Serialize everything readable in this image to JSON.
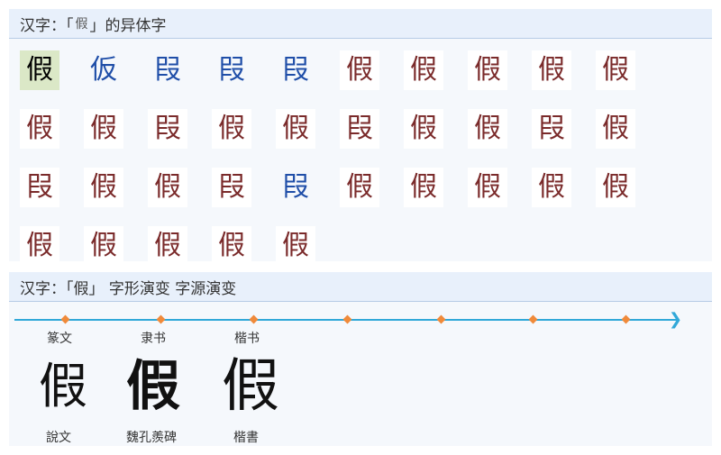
{
  "variants_section": {
    "title_prefix": "汉字：「",
    "title_char": "假",
    "title_suffix": "」的异体字",
    "glyphs": [
      {
        "char": "假",
        "style": "selected"
      },
      {
        "char": "仮",
        "style": "blue"
      },
      {
        "char": "叚",
        "style": "blue"
      },
      {
        "char": "叚",
        "style": "blue"
      },
      {
        "char": "叚",
        "style": "blue"
      },
      {
        "char": "假",
        "style": "red"
      },
      {
        "char": "假",
        "style": "red"
      },
      {
        "char": "假",
        "style": "red"
      },
      {
        "char": "假",
        "style": "red"
      },
      {
        "char": "假",
        "style": "red"
      },
      {
        "char": "假",
        "style": "red"
      },
      {
        "char": "假",
        "style": "red"
      },
      {
        "char": "叚",
        "style": "red"
      },
      {
        "char": "假",
        "style": "red"
      },
      {
        "char": "假",
        "style": "red"
      },
      {
        "char": "叚",
        "style": "red"
      },
      {
        "char": "假",
        "style": "red"
      },
      {
        "char": "假",
        "style": "red"
      },
      {
        "char": "叚",
        "style": "red"
      },
      {
        "char": "假",
        "style": "red"
      },
      {
        "char": "叚",
        "style": "red"
      },
      {
        "char": "假",
        "style": "red"
      },
      {
        "char": "假",
        "style": "red"
      },
      {
        "char": "叚",
        "style": "red"
      },
      {
        "char": "叚",
        "style": "blue"
      },
      {
        "char": "假",
        "style": "red"
      },
      {
        "char": "假",
        "style": "red"
      },
      {
        "char": "假",
        "style": "red"
      },
      {
        "char": "假",
        "style": "red"
      },
      {
        "char": "假",
        "style": "red"
      },
      {
        "char": "假",
        "style": "red"
      },
      {
        "char": "假",
        "style": "red"
      },
      {
        "char": "假",
        "style": "red"
      },
      {
        "char": "假",
        "style": "red"
      },
      {
        "char": "假",
        "style": "red"
      }
    ]
  },
  "evolution_section": {
    "title": "汉字：「假」 字形演变 字源演变",
    "stages": [
      "篆文",
      "隶书",
      "楷书"
    ],
    "glyphs": [
      "假",
      "假",
      "假"
    ],
    "sources": [
      "說文",
      "魏孔羨碑",
      "楷書"
    ]
  },
  "colors": {
    "timeline": "#31a8d8",
    "milestone": "#f08a3a",
    "variant_blue": "#1f4ea8",
    "variant_red": "#7a2a2a",
    "selected_bg": "#dbe8c7"
  }
}
